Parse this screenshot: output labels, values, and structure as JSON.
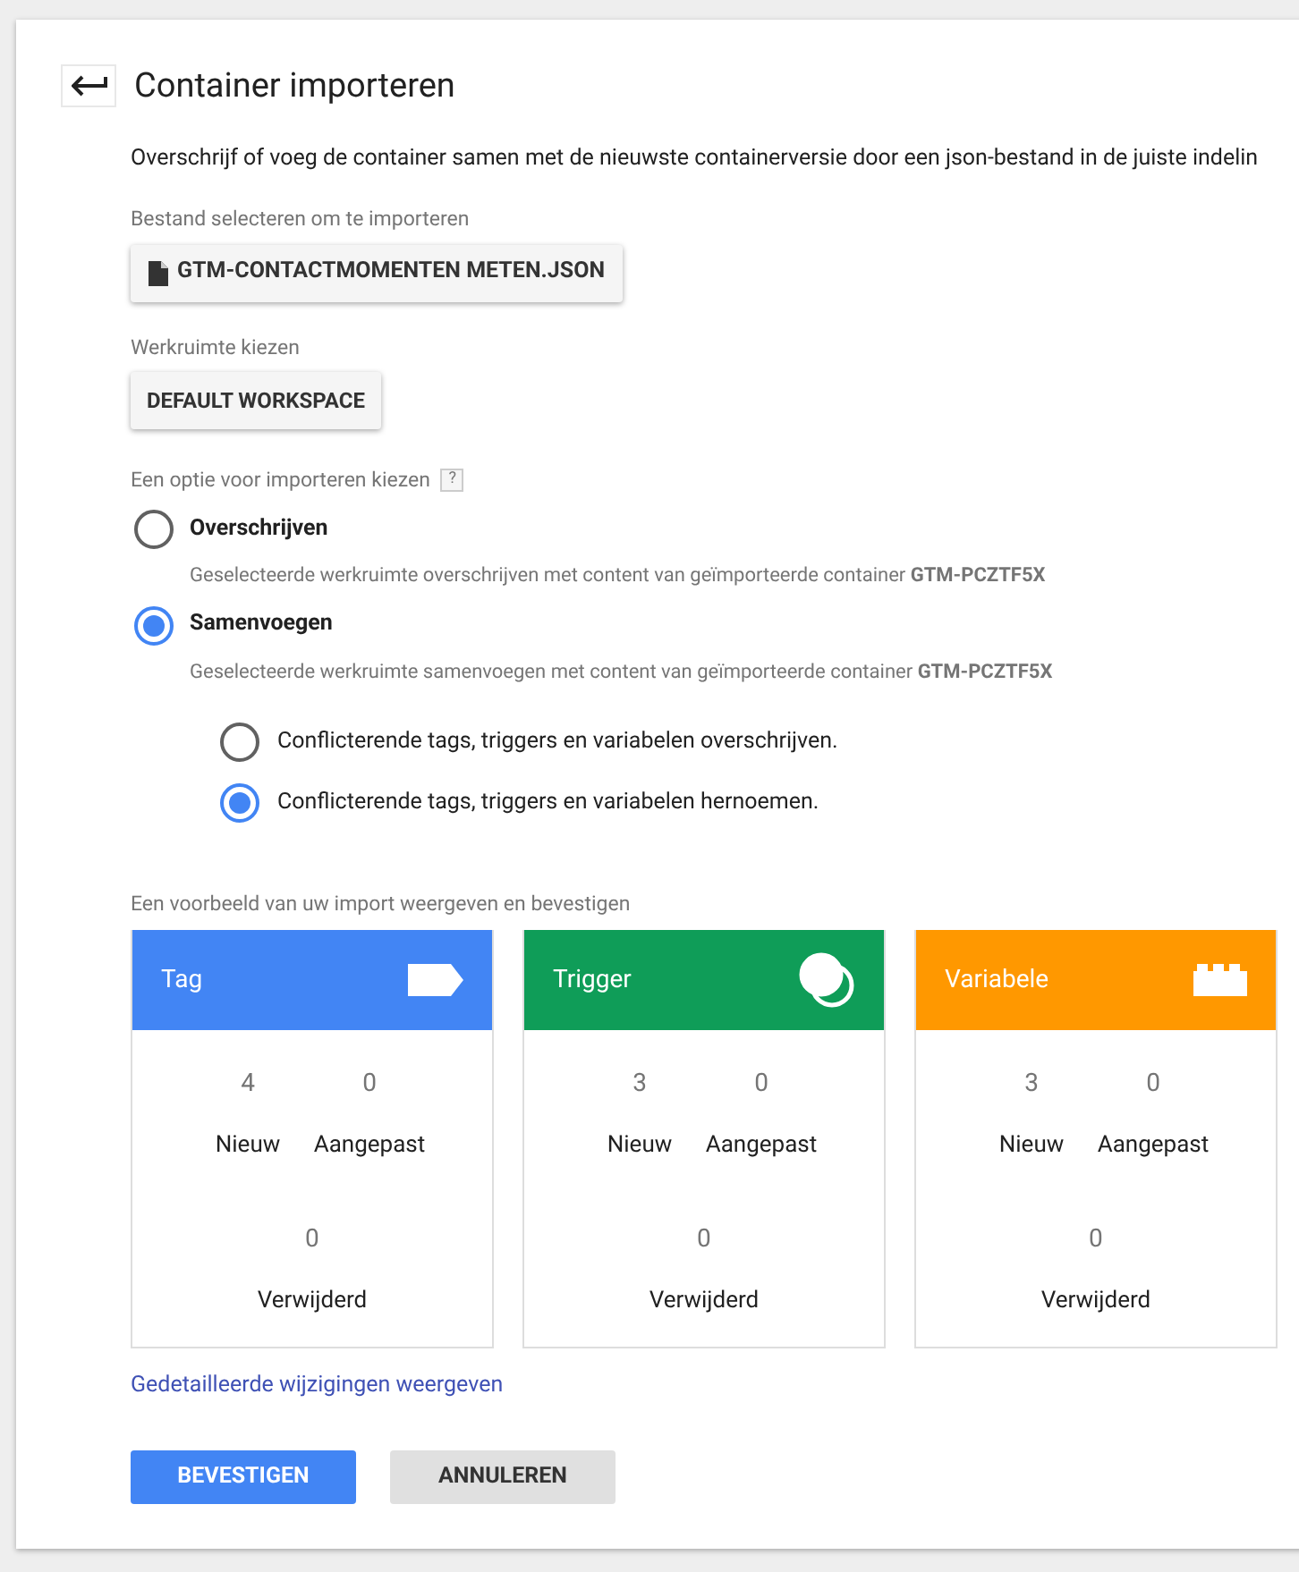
{
  "title": "Container importeren",
  "description": "Overschrijf of voeg de container samen met de nieuwste containerversie door een json-bestand in de juiste indelin",
  "file": {
    "label": "Bestand selecteren om te importeren",
    "button": "GTM-CONTACTMOMENTEN METEN.JSON"
  },
  "workspace": {
    "label": "Werkruimte kiezen",
    "button": "DEFAULT WORKSPACE"
  },
  "import_option": {
    "label": "Een optie voor importeren kiezen",
    "help": "?",
    "options": [
      {
        "label": "Overschrijven",
        "description": "Geselecteerde werkruimte overschrijven met content van geïmporteerde container **GTM-PCZTF5X**",
        "selected": false
      },
      {
        "label": "Samenvoegen",
        "description": "Geselecteerde werkruimte samenvoegen met content van geïmporteerde container **GTM-PCZTF5X**",
        "selected": true
      }
    ],
    "merge_options": [
      {
        "label": "Conflicterende tags, triggers en variabelen overschrijven.",
        "selected": false
      },
      {
        "label": "Conflicterende tags, triggers en variabelen hernoemen.",
        "selected": true
      }
    ]
  },
  "preview": {
    "label": "Een voorbeeld van uw import weergeven en bevestigen",
    "cards": [
      {
        "kind": "tag",
        "title": "Tag",
        "color": "#4285f4",
        "new": "4",
        "new_label": "Nieuw",
        "changed": "0",
        "changed_label": "Aangepast",
        "deleted": "0",
        "deleted_label": "Verwijderd"
      },
      {
        "kind": "trigger",
        "title": "Trigger",
        "color": "#0f9d58",
        "new": "3",
        "new_label": "Nieuw",
        "changed": "0",
        "changed_label": "Aangepast",
        "deleted": "0",
        "deleted_label": "Verwijderd"
      },
      {
        "kind": "variable",
        "title": "Variabele",
        "color": "#ff9800",
        "new": "3",
        "new_label": "Nieuw",
        "changed": "0",
        "changed_label": "Aangepast",
        "deleted": "0",
        "deleted_label": "Verwijderd"
      }
    ]
  },
  "details_link": "Gedetailleerde wijzigingen weergeven",
  "buttons": {
    "confirm": "BEVESTIGEN",
    "cancel": "ANNULEREN"
  }
}
